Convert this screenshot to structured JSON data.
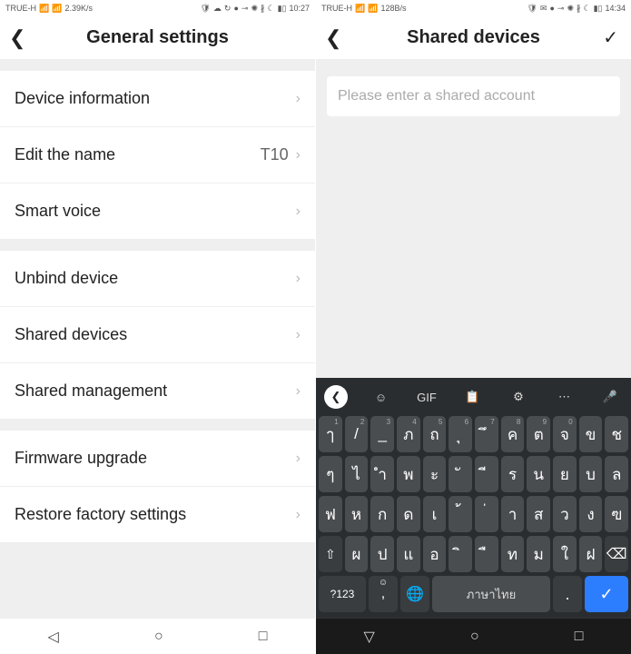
{
  "left": {
    "status": {
      "carrier": "TRUE-H",
      "speed": "2.39K/s",
      "time": "10:27"
    },
    "header": {
      "title": "General settings"
    },
    "rows": {
      "device_info": "Device information",
      "edit_name": "Edit the name",
      "edit_name_value": "T10",
      "smart_voice": "Smart voice",
      "unbind": "Unbind device",
      "shared_devices": "Shared devices",
      "shared_mgmt": "Shared management",
      "firmware": "Firmware upgrade",
      "restore": "Restore factory settings"
    }
  },
  "right": {
    "status": {
      "carrier": "TRUE-H",
      "speed": "128B/s",
      "time": "14:34"
    },
    "header": {
      "title": "Shared devices"
    },
    "input": {
      "placeholder": "Please enter a shared account"
    },
    "keyboard": {
      "toolbar_gif": "GIF",
      "row1": [
        "ๅ",
        "/",
        "_",
        "ภ",
        "ถ",
        "ุ",
        "ึ",
        "ค",
        "ต",
        "จ",
        "ข",
        "ช"
      ],
      "row1_sup": [
        "1",
        "2",
        "3",
        "4",
        "5",
        "6",
        "7",
        "8",
        "9",
        "0",
        "",
        ""
      ],
      "row2": [
        "ๆ",
        "ไ",
        "ำ",
        "พ",
        "ะ",
        "ั",
        "ี",
        "ร",
        "น",
        "ย",
        "บ",
        "ล"
      ],
      "row3": [
        "ฟ",
        "ห",
        "ก",
        "ด",
        "เ",
        "้",
        "่",
        "า",
        "ส",
        "ว",
        "ง",
        "ฃ"
      ],
      "row4": [
        "ผ",
        "ป",
        "แ",
        "อ",
        "ิ",
        "ื",
        "ท",
        "ม",
        "ใ",
        "ฝ"
      ],
      "num_key": "?123",
      "space": "ภาษาไทย"
    }
  }
}
